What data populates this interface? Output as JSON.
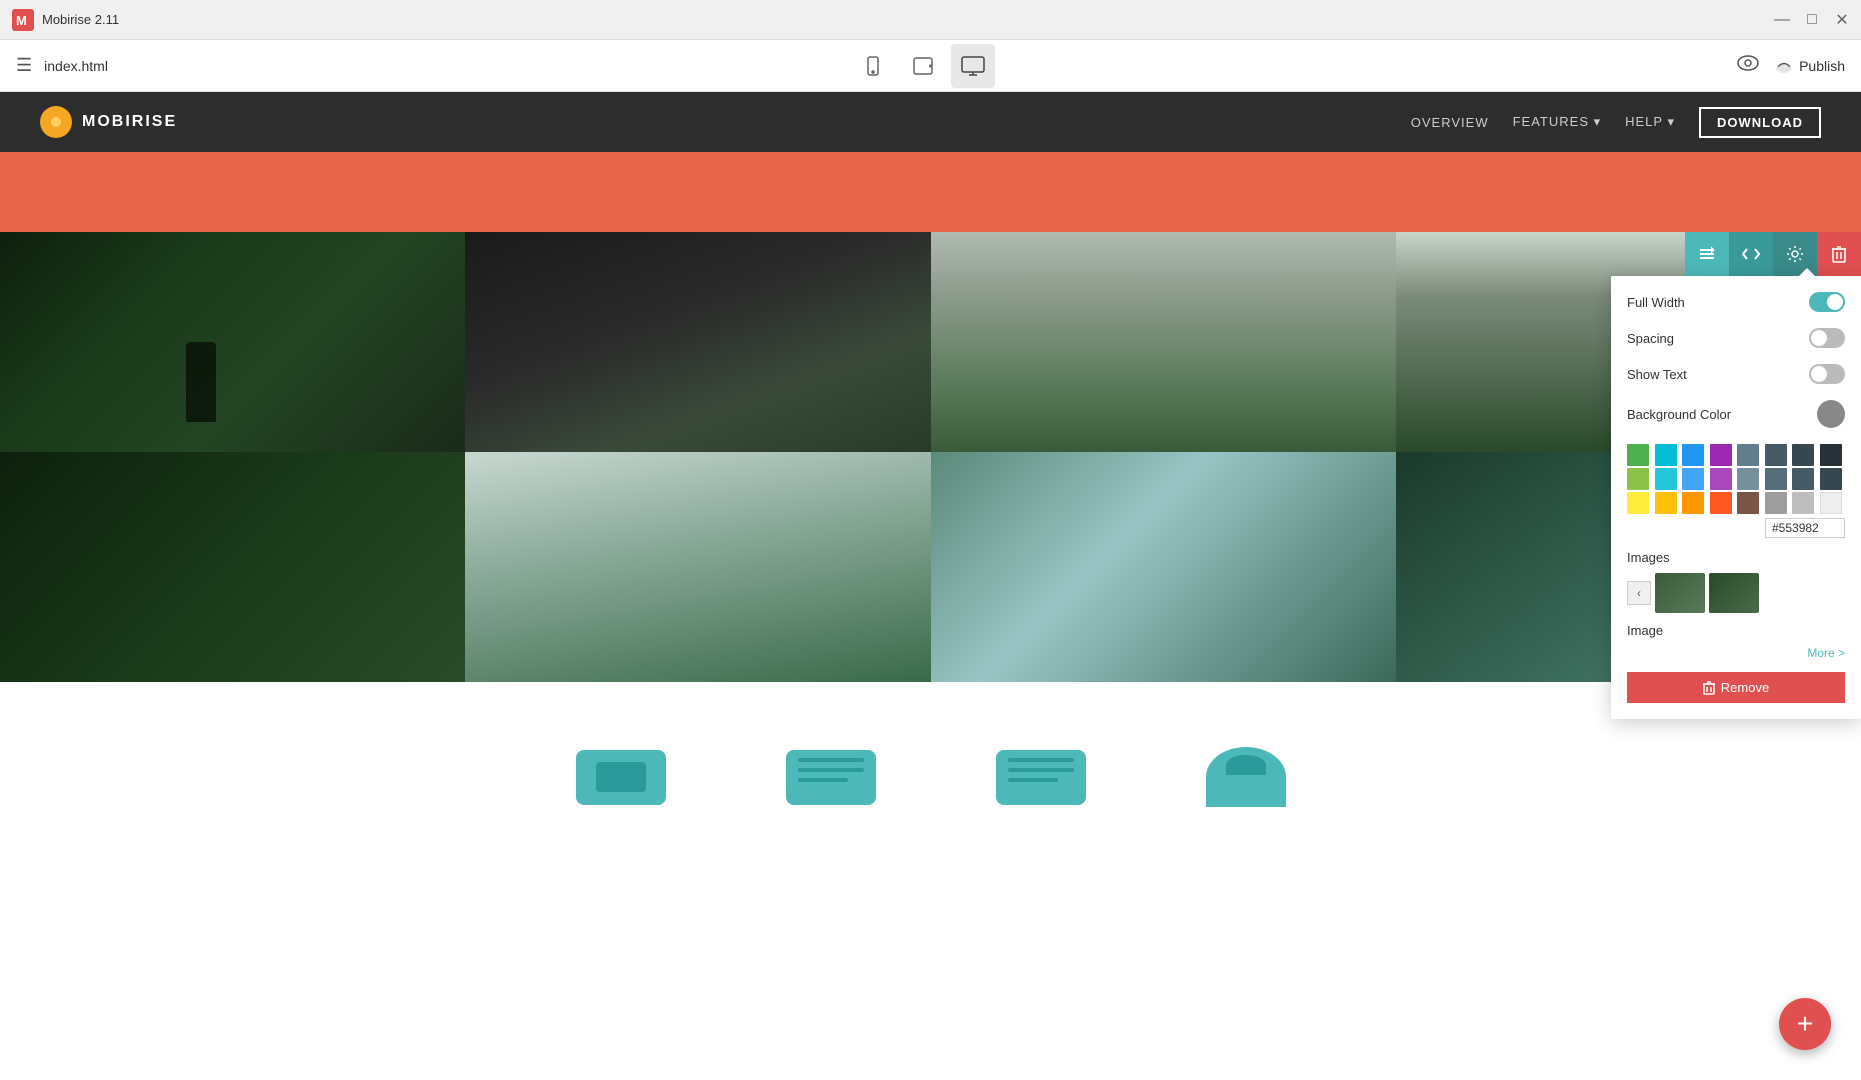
{
  "titlebar": {
    "app_name": "Mobirise 2.11",
    "minimize_icon": "—",
    "maximize_icon": "□",
    "close_icon": "✕"
  },
  "toolbar": {
    "menu_icon": "☰",
    "filename": "index.html",
    "devices": [
      {
        "label": "mobile",
        "icon": "📱",
        "active": false
      },
      {
        "label": "tablet",
        "icon": "📟",
        "active": false
      },
      {
        "label": "desktop",
        "icon": "🖥",
        "active": true
      }
    ],
    "preview_icon": "👁",
    "publish_icon": "☁",
    "publish_label": "Publish"
  },
  "site": {
    "navbar": {
      "logo_text": "MOBIRISE",
      "nav_items": [
        "OVERVIEW",
        "FEATURES ▾",
        "HELP ▾"
      ],
      "nav_cta": "DOWNLOAD"
    },
    "gallery": {
      "images": [
        {
          "id": 1,
          "class": "img-forest-1"
        },
        {
          "id": 2,
          "class": "img-forest-2"
        },
        {
          "id": 3,
          "class": "img-forest-3"
        },
        {
          "id": 4,
          "class": "img-forest-4"
        },
        {
          "id": 5,
          "class": "img-forest-5"
        },
        {
          "id": 6,
          "class": "img-forest-6"
        },
        {
          "id": 7,
          "class": "img-forest-7"
        },
        {
          "id": 8,
          "class": "img-forest-8"
        }
      ]
    }
  },
  "section_toolbar": {
    "reorder_icon": "↕",
    "code_icon": "<>",
    "settings_icon": "⚙",
    "delete_icon": "🗑"
  },
  "settings_panel": {
    "full_width_label": "Full Width",
    "full_width_on": true,
    "spacing_label": "Spacing",
    "spacing_on": false,
    "show_text_label": "Show Text",
    "show_text_on": false,
    "bg_color_label": "Background Color",
    "images_label": "Images",
    "image_label": "Image",
    "more_link": "More >",
    "remove_label": "Remove",
    "remove_icon": "🗑"
  },
  "color_picker": {
    "hex_value": "#553982",
    "colors_row1": [
      "#4caf50",
      "#00bcd4",
      "#2196f3",
      "#9c27b0",
      "#607d8b",
      "#455a64",
      "#37474f",
      "#263238"
    ],
    "colors_row2": [
      "#8bc34a",
      "#26c6da",
      "#42a5f5",
      "#ab47bc",
      "#78909c",
      "#546e7a",
      "#455a64",
      "#37474f"
    ],
    "colors_row3": [
      "#ffeb3b",
      "#ffc107",
      "#ff9800",
      "#ff5722",
      "#795548",
      "#9e9e9e",
      "#bdbdbd",
      "#eeeeee"
    ],
    "colors_row4": [
      "#f9a825",
      "#f57f17",
      "#e65100",
      "#bf360c",
      "#4e342e",
      "#757575",
      "#e0e0e0",
      "#ffffff"
    ],
    "swatches": [
      "#4caf50",
      "#00bcd4",
      "#2196f3",
      "#9c27b0",
      "#607d8b",
      "#8bc34a",
      "#26c6da",
      "#42a5f5",
      "#ab47bc",
      "#78909c",
      "#ffeb3b",
      "#ffc107",
      "#ff9800",
      "#ff5722",
      "#795548",
      "#9e9e9e",
      "#f9a825",
      "#f57f17",
      "#e65100",
      "#bf360c",
      "#4e342e",
      "#757575",
      "#e0e0e0",
      "#212121"
    ]
  },
  "fab": {
    "icon": "+"
  }
}
